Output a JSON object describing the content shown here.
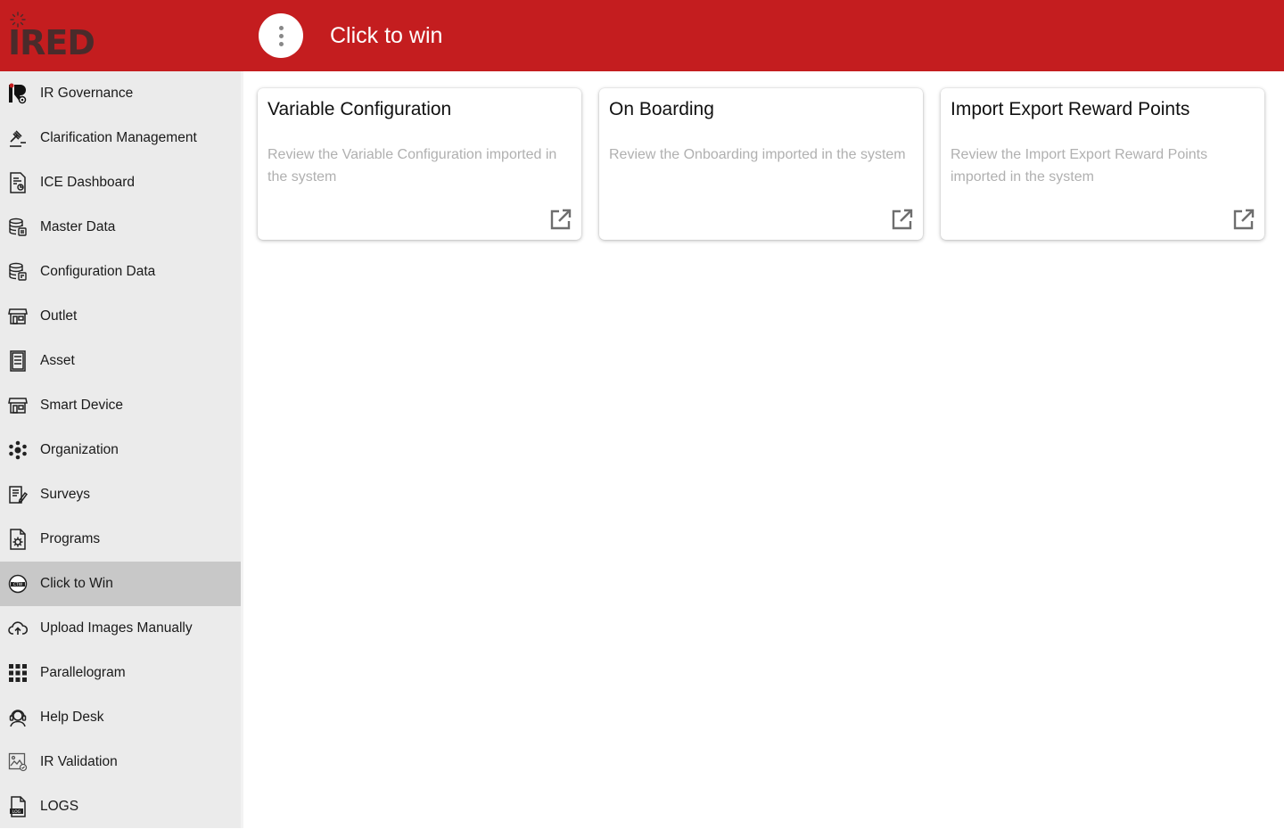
{
  "app": {
    "logo_text": "IRED",
    "page_title": "Click to win",
    "brand_color": "#c41d1f"
  },
  "sidebar": {
    "items": [
      {
        "label": "IR Governance",
        "icon": "ir-logo-icon"
      },
      {
        "label": "Clarification Management",
        "icon": "gavel-icon"
      },
      {
        "label": "ICE Dashboard",
        "icon": "document-chart-icon"
      },
      {
        "label": "Master Data",
        "icon": "database-icon"
      },
      {
        "label": "Configuration Data",
        "icon": "database-config-icon"
      },
      {
        "label": "Outlet",
        "icon": "store-icon"
      },
      {
        "label": "Asset",
        "icon": "cooler-icon"
      },
      {
        "label": "Smart Device",
        "icon": "store-device-icon"
      },
      {
        "label": "Organization",
        "icon": "network-icon"
      },
      {
        "label": "Surveys",
        "icon": "survey-icon"
      },
      {
        "label": "Programs",
        "icon": "document-gear-icon"
      },
      {
        "label": "Click to Win",
        "icon": "ctw-icon",
        "active": true
      },
      {
        "label": "Upload Images Manually",
        "icon": "cloud-upload-icon"
      },
      {
        "label": "Parallelogram",
        "icon": "grid-icon"
      },
      {
        "label": "Help Desk",
        "icon": "headset-icon"
      },
      {
        "label": "IR Validation",
        "icon": "image-check-icon"
      },
      {
        "label": "LOGS",
        "icon": "log-file-icon"
      }
    ]
  },
  "cards": [
    {
      "title": "Variable Configuration",
      "description": "Review the Variable Configuration imported in the system",
      "icon": "open-in-new-icon"
    },
    {
      "title": "On Boarding",
      "description": "Review the Onboarding imported in the system",
      "icon": "open-in-new-icon"
    },
    {
      "title": "Import Export Reward Points",
      "description": "Review the Import Export Reward Points imported in the system",
      "icon": "open-in-new-icon"
    }
  ]
}
